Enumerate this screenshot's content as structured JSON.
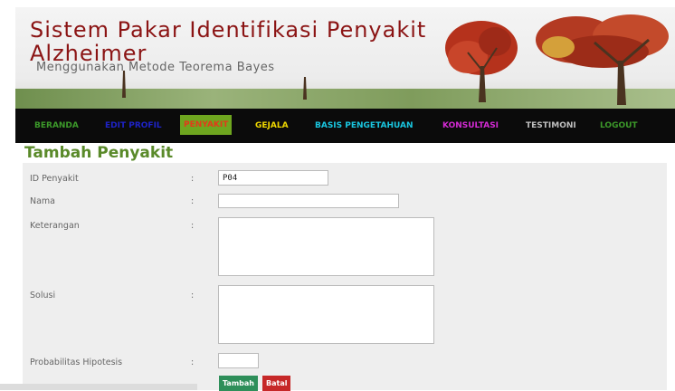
{
  "header": {
    "title": "Sistem Pakar Identifikasi Penyakit Alzheimer",
    "subtitle": "Menggunakan Metode Teorema Bayes"
  },
  "nav": {
    "items": [
      {
        "label": "BERANDA",
        "color": "#3c9a2a"
      },
      {
        "label": "EDIT PROFIL",
        "color": "#1e23c8"
      },
      {
        "label": "PENYAKIT",
        "color": "#e23a1a",
        "active": true
      },
      {
        "label": "GEJALA",
        "color": "#f0d800"
      },
      {
        "label": "BASIS PENGETAHUAN",
        "color": "#19c6e0"
      },
      {
        "label": "KONSULTASI",
        "color": "#d42ad4"
      },
      {
        "label": "TESTIMONI",
        "color": "#bfbfbf"
      },
      {
        "label": "LOGOUT",
        "color": "#3c9a2a"
      }
    ]
  },
  "form": {
    "heading": "Tambah Penyakit",
    "colon": ":",
    "id_label": "ID Penyakit",
    "id_value": "P04",
    "nama_label": "Nama",
    "nama_value": "",
    "keterangan_label": "Keterangan",
    "keterangan_value": "",
    "solusi_label": "Solusi",
    "solusi_value": "",
    "prob_label": "Probabilitas Hipotesis",
    "prob_value": "",
    "submit_label": "Tambah",
    "cancel_label": "Batal"
  },
  "colors": {
    "title": "#8b1414",
    "heading": "#5a8a2a",
    "submit_button": "#2e8f5a",
    "cancel_button": "#c62828",
    "nav_active_bg": "#6ea51f"
  }
}
